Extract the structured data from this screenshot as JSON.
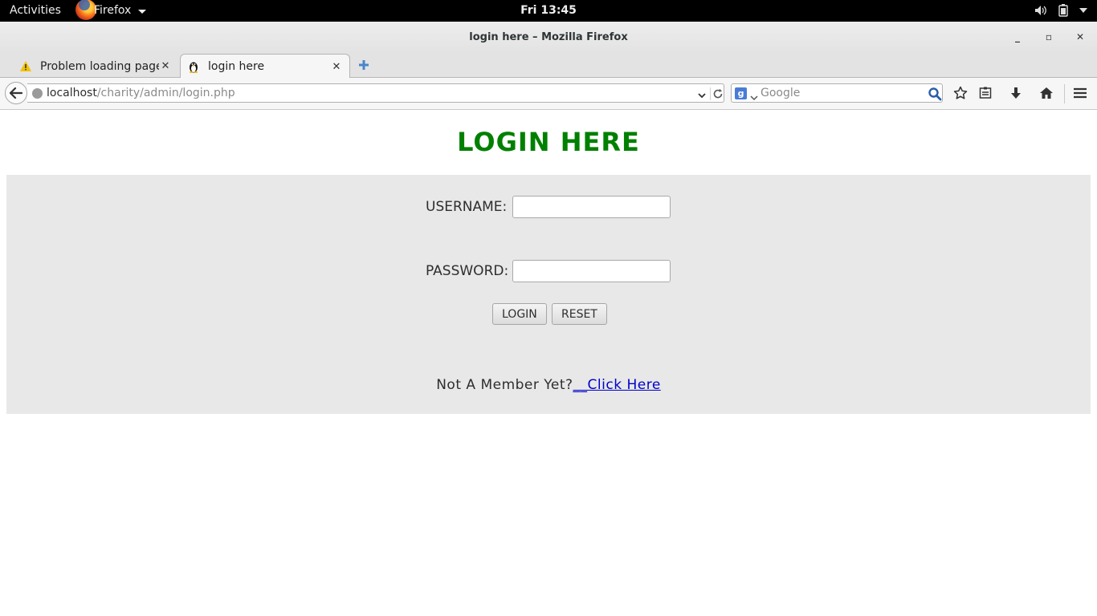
{
  "system": {
    "activities_label": "Activities",
    "app_menu_label": "Firefox",
    "clock": "Fri 13:45"
  },
  "window": {
    "title": "login here – Mozilla Firefox"
  },
  "tabs": [
    {
      "label": "Problem loading page",
      "icon": "warning-icon",
      "active": false
    },
    {
      "label": "login here",
      "icon": "tux-icon",
      "active": true
    }
  ],
  "navigation": {
    "url_host": "localhost",
    "url_path": "/charity/admin/login.php",
    "search_placeholder": "Google",
    "search_engine_letter": "g"
  },
  "page": {
    "heading": "LOGIN HERE",
    "username_label": "USERNAME:",
    "username_value": "",
    "password_label": "PASSWORD:",
    "password_value": "",
    "login_button": "LOGIN",
    "reset_button": "RESET",
    "member_prompt": "Not A Member Yet?",
    "member_link": "__Click Here"
  },
  "colors": {
    "heading": "#008000",
    "panel_bg": "#e8e8e8",
    "link": "#0000cc"
  }
}
